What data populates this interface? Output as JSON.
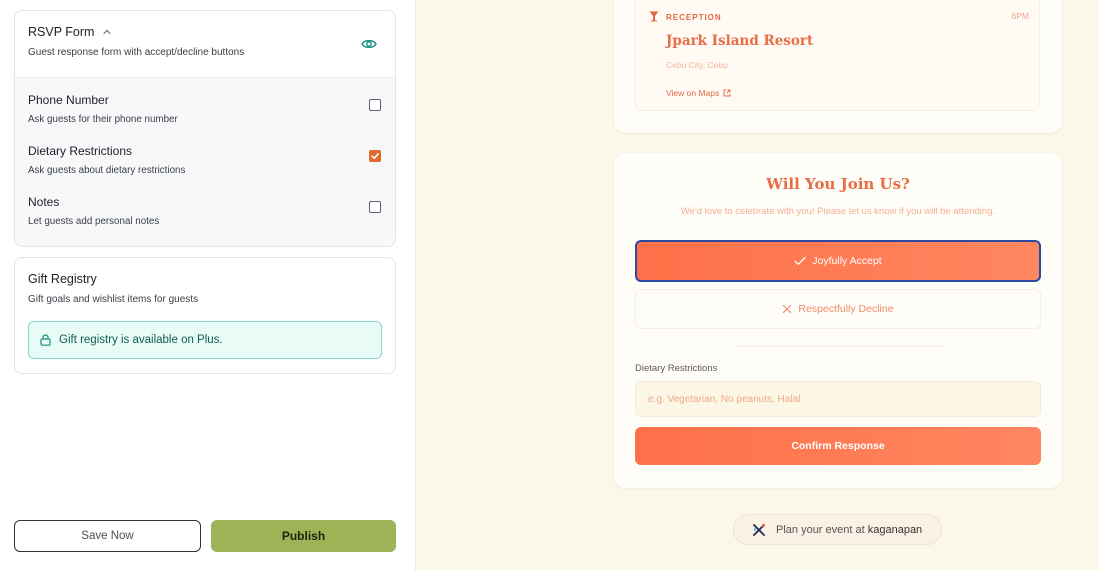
{
  "editor": {
    "rsvp_form": {
      "title": "RSVP Form",
      "subtitle": "Guest response form with accept/decline buttons",
      "options": [
        {
          "title": "Phone Number",
          "subtitle": "Ask guests for their phone number",
          "checked": false
        },
        {
          "title": "Dietary Restrictions",
          "subtitle": "Ask guests about dietary restrictions",
          "checked": true
        },
        {
          "title": "Notes",
          "subtitle": "Let guests add personal notes",
          "checked": false
        }
      ]
    },
    "gift_registry": {
      "title": "Gift Registry",
      "subtitle": "Gift goals and wishlist items for guests",
      "notice": "Gift registry is available on Plus."
    },
    "actions": {
      "save_label": "Save Now",
      "publish_label": "Publish"
    }
  },
  "preview": {
    "reception": {
      "label": "RECEPTION",
      "time": "6PM",
      "venue": "Jpark Island Resort",
      "city": "Cebu City, Cebu",
      "map_link": "View on Maps"
    },
    "rsvp": {
      "title": "Will You Join Us?",
      "subtitle": "We'd love to celebrate with you! Please let us know if you will be attending.",
      "accept_label": "Joyfully Accept",
      "decline_label": "Respectfully Decline",
      "dietary_label": "Dietary Restrictions",
      "dietary_placeholder": "e.g. Vegetarian, No peanuts, Halal",
      "confirm_label": "Confirm Response"
    },
    "promo": {
      "prefix": "Plan your event at",
      "brand": "kaganapan"
    }
  },
  "colors": {
    "accent": "#fe7049",
    "publish": "#9db355",
    "checkbox_on": "#e06a2a",
    "notice_bg": "#e9fbf6",
    "preview_bg": "#fbf8e9"
  }
}
